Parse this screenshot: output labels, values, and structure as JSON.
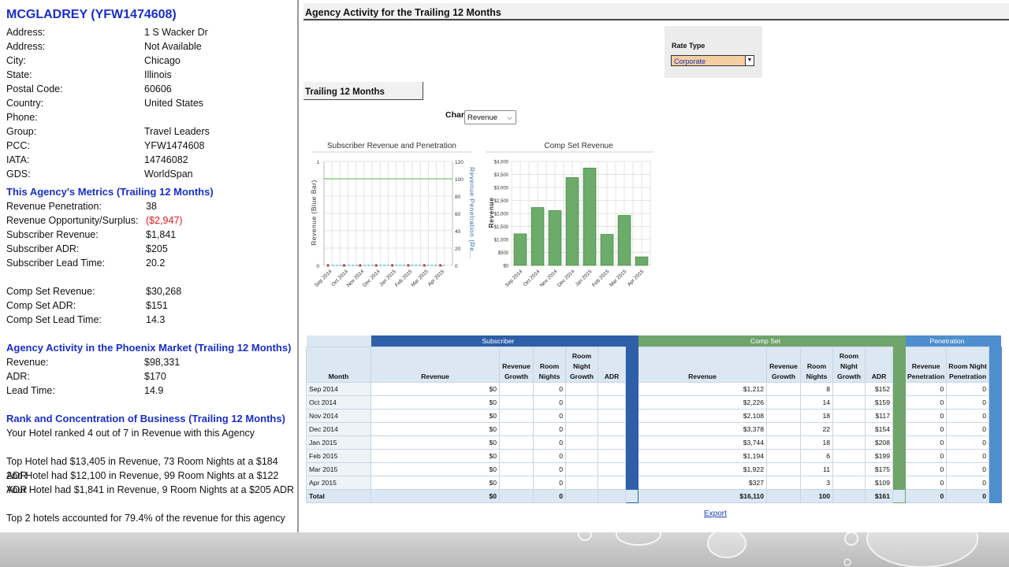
{
  "agency": {
    "title": "MCGLADREY (YFW1474608)",
    "info": [
      {
        "label": "Address:",
        "value": "1 S Wacker Dr"
      },
      {
        "label": "Address:",
        "value": "Not Available"
      },
      {
        "label": "City:",
        "value": "Chicago"
      },
      {
        "label": "State:",
        "value": "Illinois"
      },
      {
        "label": "Postal Code:",
        "value": "60606"
      },
      {
        "label": "Country:",
        "value": "United States"
      },
      {
        "label": "Phone:",
        "value": ""
      },
      {
        "label": "Group:",
        "value": "Travel Leaders"
      },
      {
        "label": "PCC:",
        "value": "YFW1474608"
      },
      {
        "label": "IATA:",
        "value": "14746082"
      },
      {
        "label": "GDS:",
        "value": "WorldSpan"
      }
    ]
  },
  "metrics": {
    "title": "This Agency's Metrics (Trailing 12 Months)",
    "rows": [
      {
        "label": "Revenue Penetration:",
        "value": "38"
      },
      {
        "label": "Revenue Opportunity/Surplus:",
        "value": "($2,947)"
      },
      {
        "label": "Subscriber Revenue:",
        "value": "$1,841"
      },
      {
        "label": "Subscriber ADR:",
        "value": "$205"
      },
      {
        "label": "Subscriber Lead Time:",
        "value": "20.2"
      }
    ],
    "comp_rows": [
      {
        "label": "Comp Set Revenue:",
        "value": "$30,268"
      },
      {
        "label": "Comp Set ADR:",
        "value": "$151"
      },
      {
        "label": "Comp Set Lead Time:",
        "value": "14.3"
      }
    ]
  },
  "market": {
    "title": "Agency Activity in the Phoenix Market (Trailing 12 Months)",
    "rows": [
      {
        "label": "Revenue:",
        "value": "$98,331"
      },
      {
        "label": "ADR:",
        "value": "$170"
      },
      {
        "label": "Lead Time:",
        "value": "14.9"
      }
    ]
  },
  "rank": {
    "title": "Rank and Concentration of Business (Trailing 12 Months)",
    "line1": "Your Hotel ranked 4 out of 7 in Revenue with this Agency",
    "line2": "Top Hotel had $13,405 in Revenue, 73 Room Nights at a $184 ADR",
    "line3": "2nd Hotel had $12,100 in Revenue, 99 Room Nights at a $122 ADR",
    "line4": "Your Hotel had $1,841 in Revenue, 9 Room Nights at a $205 ADR",
    "line5": "Top 2 hotels accounted for 79.4% of the revenue for this agency"
  },
  "header": {
    "title": "Agency Activity for the Trailing 12 Months"
  },
  "rate_type": {
    "label": "Rate Type",
    "value": "Corporate"
  },
  "tab": {
    "label": "Trailing 12 Months"
  },
  "chart_selector": {
    "label": "Chart",
    "value": "Revenue"
  },
  "chart_data": [
    {
      "type": "line",
      "title": "Subscriber Revenue and Penetration",
      "ylabel": "Revenue (Blue Bar)",
      "y2label": "Revenue Penetration (Re...",
      "categories": [
        "Sep 2014",
        "Oct 2014",
        "Nov 2014",
        "Dec 2014",
        "Jan 2015",
        "Feb 2015",
        "Mar 2015",
        "Apr 2015"
      ],
      "ylim": [
        0,
        1
      ],
      "y_ticks": [
        "0",
        "1"
      ],
      "y2lim": [
        0,
        120
      ],
      "y2_ticks": [
        "0",
        "20",
        "40",
        "60",
        "80",
        "100",
        "120"
      ],
      "series": [
        {
          "values": [
            0,
            0,
            0,
            0,
            0,
            0,
            0,
            0
          ]
        },
        {
          "values": [
            0,
            0,
            0,
            0,
            0,
            0,
            0,
            0
          ]
        }
      ],
      "reference_line": 100,
      "grid": true,
      "colors": {
        "bar": "#3b6fb6",
        "penetration": "#c0392b",
        "reference": "#7dbf6a"
      }
    },
    {
      "type": "bar",
      "title": "Comp Set Revenue",
      "ylabel": "Revenue",
      "categories": [
        "Sep 2014",
        "Oct 2014",
        "Nov 2014",
        "Dec 2014",
        "Jan 2015",
        "Feb 2015",
        "Mar 2015",
        "Apr 2015"
      ],
      "values": [
        1212,
        2226,
        2108,
        3378,
        3744,
        1194,
        1922,
        327
      ],
      "ylim": [
        0,
        4000
      ],
      "y_ticks": [
        "$0",
        "$500",
        "$1,000",
        "$1,500",
        "$2,000",
        "$2,500",
        "$3,000",
        "$3,500",
        "$4,000"
      ],
      "grid": true,
      "colors": {
        "bar": "#6dab6b",
        "bar_edge": "#4e8a4c"
      }
    }
  ],
  "table": {
    "groups": {
      "subscriber": "Subscriber",
      "compset": "Comp Set",
      "penetration": "Penetration"
    },
    "columns": {
      "month": "Month",
      "revenue": "Revenue",
      "rev_growth_1": "Revenue",
      "rev_growth_2": "Growth",
      "room_nights_1": "Room",
      "room_nights_2": "Nights",
      "rn_growth_1": "Room",
      "rn_growth_2": "Night",
      "rn_growth_3": "Growth",
      "adr": "ADR",
      "rev_pen_1": "Revenue",
      "rev_pen_2": "Penetration",
      "rn_pen_1": "Room Night",
      "rn_pen_2": "Penetration"
    },
    "rows": [
      {
        "month": "Sep 2014",
        "s_rev": "$0",
        "s_rn": "0",
        "c_rev": "$1,212",
        "c_rn": "8",
        "c_adr": "$152",
        "p_rev": "0",
        "p_rn": "0"
      },
      {
        "month": "Oct 2014",
        "s_rev": "$0",
        "s_rn": "0",
        "c_rev": "$2,226",
        "c_rn": "14",
        "c_adr": "$159",
        "p_rev": "0",
        "p_rn": "0"
      },
      {
        "month": "Nov 2014",
        "s_rev": "$0",
        "s_rn": "0",
        "c_rev": "$2,108",
        "c_rn": "18",
        "c_adr": "$117",
        "p_rev": "0",
        "p_rn": "0"
      },
      {
        "month": "Dec 2014",
        "s_rev": "$0",
        "s_rn": "0",
        "c_rev": "$3,378",
        "c_rn": "22",
        "c_adr": "$154",
        "p_rev": "0",
        "p_rn": "0"
      },
      {
        "month": "Jan 2015",
        "s_rev": "$0",
        "s_rn": "0",
        "c_rev": "$3,744",
        "c_rn": "18",
        "c_adr": "$208",
        "p_rev": "0",
        "p_rn": "0"
      },
      {
        "month": "Feb 2015",
        "s_rev": "$0",
        "s_rn": "0",
        "c_rev": "$1,194",
        "c_rn": "6",
        "c_adr": "$199",
        "p_rev": "0",
        "p_rn": "0"
      },
      {
        "month": "Mar 2015",
        "s_rev": "$0",
        "s_rn": "0",
        "c_rev": "$1,922",
        "c_rn": "11",
        "c_adr": "$175",
        "p_rev": "0",
        "p_rn": "0"
      },
      {
        "month": "Apr 2015",
        "s_rev": "$0",
        "s_rn": "0",
        "c_rev": "$327",
        "c_rn": "3",
        "c_adr": "$109",
        "p_rev": "0",
        "p_rn": "0"
      }
    ],
    "total": {
      "label": "Total",
      "s_rev": "$0",
      "s_rn": "0",
      "c_rev": "$16,110",
      "c_rn": "100",
      "c_adr": "$161",
      "p_rev": "0",
      "p_rn": "0"
    }
  },
  "export": {
    "label": "Export"
  },
  "colors": {
    "subscriber": "#2e5fa8",
    "compset": "#6fa56a",
    "penetration": "#4f8fcf",
    "title_blue": "#1a2ec8",
    "negative": "#e31b1b"
  }
}
